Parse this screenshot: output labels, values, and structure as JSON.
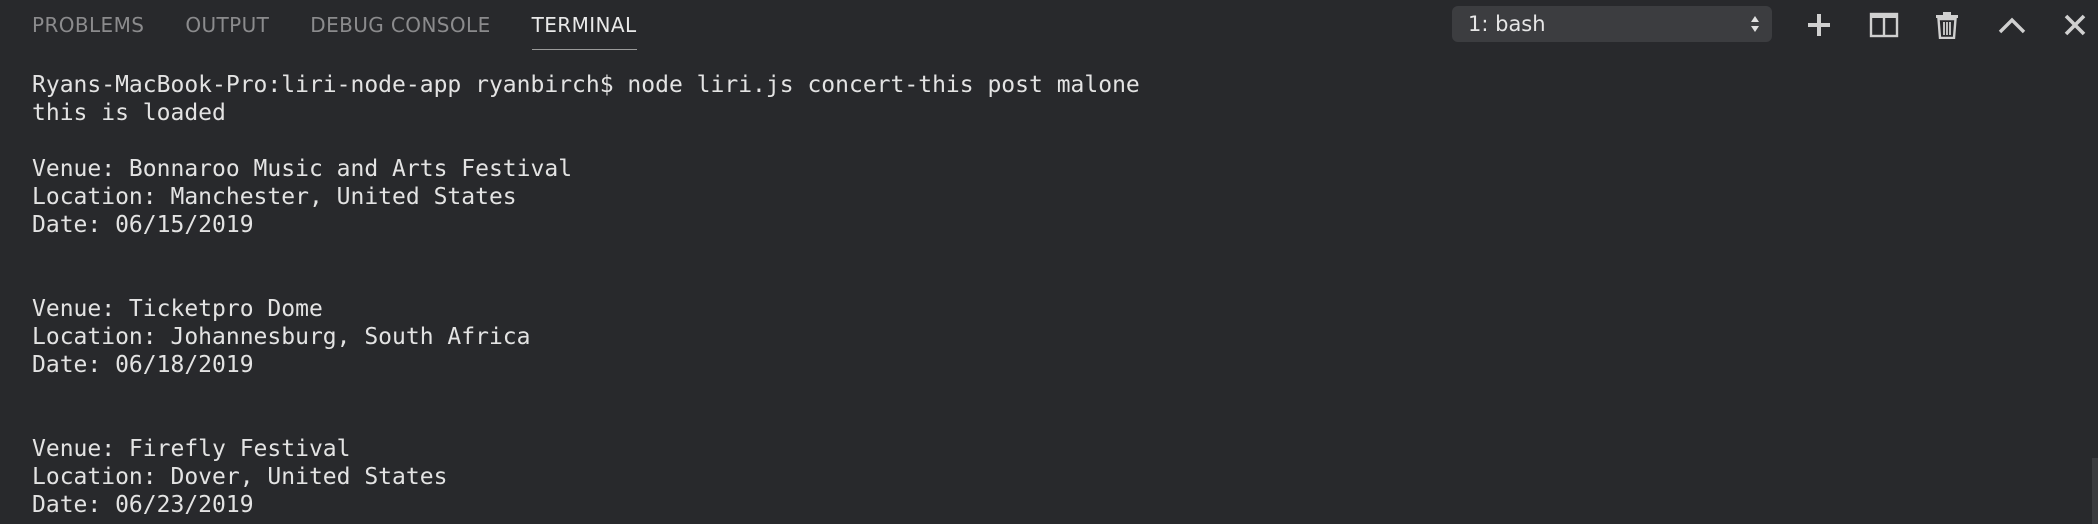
{
  "panel": {
    "tabs": [
      {
        "label": "PROBLEMS"
      },
      {
        "label": "OUTPUT"
      },
      {
        "label": "DEBUG CONSOLE"
      },
      {
        "label": "TERMINAL"
      }
    ],
    "active_tab": "TERMINAL",
    "terminal_select": {
      "value": "1: bash"
    },
    "toolbar_icons": [
      "plus-icon",
      "split-icon",
      "trash-icon",
      "chevron-up-icon",
      "close-icon"
    ]
  },
  "terminal": {
    "lines": [
      "Ryans-MacBook-Pro:liri-node-app ryanbirch$ node liri.js concert-this post malone",
      "this is loaded",
      "",
      "Venue: Bonnaroo Music and Arts Festival",
      "Location: Manchester, United States",
      "Date: 06/15/2019",
      "",
      "",
      "Venue: Ticketpro Dome",
      "Location: Johannesburg, South Africa",
      "Date: 06/18/2019",
      "",
      "",
      "Venue: Firefly Festival",
      "Location: Dover, United States",
      "Date: 06/23/2019"
    ]
  },
  "colors": {
    "background": "#28292c",
    "tab_inactive": "#8b8b8d",
    "tab_active": "#e9e9e9",
    "text": "#e3e3e3",
    "select_bg": "#3c3d40",
    "icon": "#cfcfcf"
  }
}
